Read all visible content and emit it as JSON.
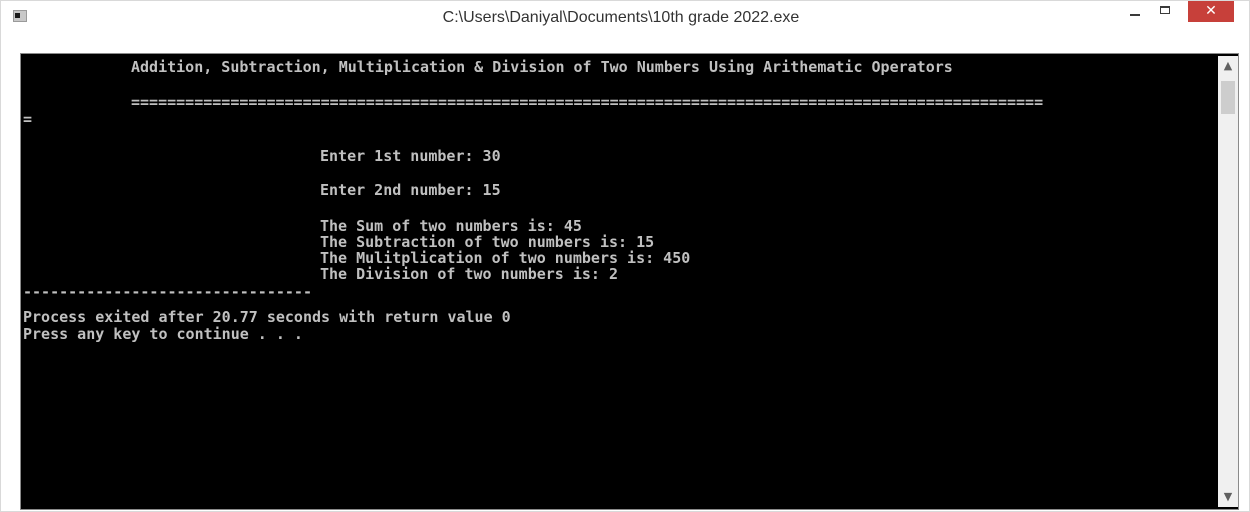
{
  "window": {
    "title": "C:\\Users\\Daniyal\\Documents\\10th grade 2022.exe",
    "icons": {
      "app": "console-app-icon",
      "minimize": "minimize-icon",
      "maximize": "maximize-icon",
      "close": "close-icon"
    },
    "close_glyph": "✕",
    "accent_close": "#c7403a"
  },
  "console": {
    "background": "#000000",
    "text_color": "#c0c0c0",
    "heading": "Addition, Subtraction, Multiplication & Division of Two Numbers Using Arithematic Operators",
    "separator": "=====================================================================================================",
    "separator_wrap": "=",
    "prompt_first": "Enter 1st number: 30",
    "prompt_second": "Enter 2nd number: 15",
    "result_sum": "The Sum of two numbers is: 45",
    "result_sub": "The Subtraction of two numbers is: 15",
    "result_mul": "The Mulitplication of two numbers is: 450",
    "result_div": "The Division of two numbers is: 2",
    "divider": "--------------------------------",
    "exit_message": "Process exited after 20.77 seconds with return value 0",
    "continue_prompt": "Press any key to continue . . ."
  },
  "scrollbar": {
    "up_arrow": "▲",
    "down_arrow": "▼"
  }
}
